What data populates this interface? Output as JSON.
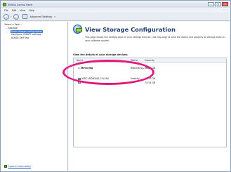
{
  "window": {
    "title": "NVIDIA Control Panel",
    "buttons": {
      "minimize": "–",
      "maximize": "□",
      "close": "x"
    }
  },
  "menu": [
    "File",
    "Edit",
    "View",
    "Help"
  ],
  "toolbar": {
    "back": "‹",
    "forward": "›",
    "dropdown": "▾",
    "settings_label": "Advanced Settings",
    "settings_chevron": "▾"
  },
  "sidebar": {
    "heading": "Select a Task...",
    "tree_root": "Storage",
    "tree_toggle": "−",
    "items": [
      {
        "label": "View storage configuration"
      },
      {
        "label": "Configure SMART settings"
      },
      {
        "label": "(RAID) Self Test"
      }
    ],
    "footer_link": "System Information"
  },
  "main": {
    "title": "View Storage Configuration",
    "description": "This page shows the configuration of your storage devices. Use this page to view the status and capacity of storage disks on your software system.",
    "section_heading": "View the details of your storage devices:",
    "columns": [
      "Name",
      "Status",
      "Capacity"
    ],
    "rows": [
      {
        "toggle": "⊕",
        "name": "Mirroring",
        "status": "Rebuilding (29%)",
        "capacity": "75.00 GB"
      },
      {
        "toggle": "",
        "name": "WDC WD800JD-22LSA0",
        "status": "Healthy",
        "capacity": "74.53 GB"
      },
      {
        "toggle": "",
        "name": "",
        "status": "",
        "capacity": "74.54 GB"
      }
    ]
  },
  "colors": {
    "accent": "#1f3d73",
    "selection": "#3b7dd8",
    "highlight_ring": "#e3187e",
    "link": "#1a4fb5"
  }
}
